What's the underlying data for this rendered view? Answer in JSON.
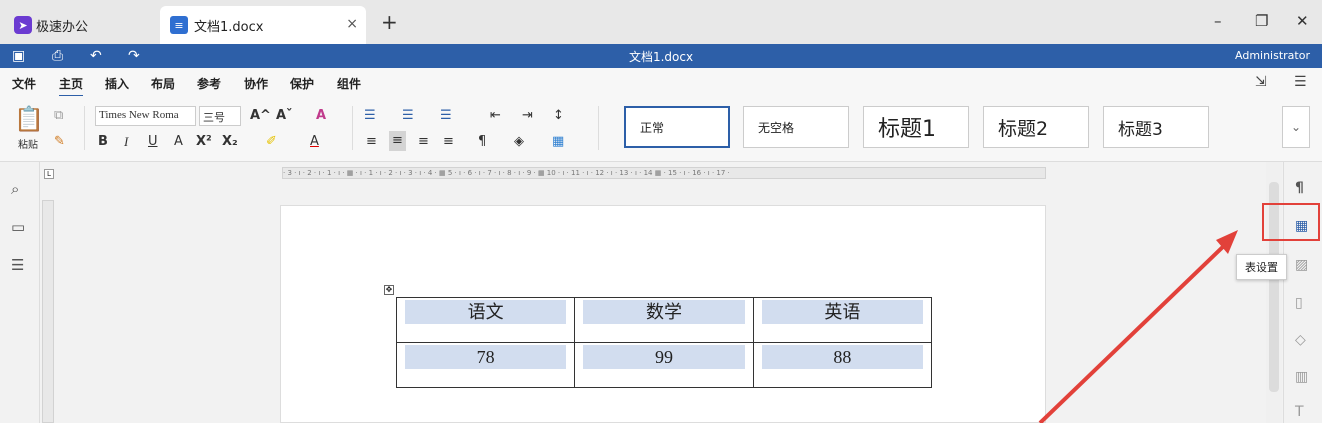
{
  "tabs": {
    "app_label": "极速办公",
    "doc_label": "文档1.docx",
    "close_glyph": "×",
    "new_tab_glyph": "+"
  },
  "window": {
    "minimize": "–",
    "restore": "❐",
    "close": "✕"
  },
  "titlebar": {
    "title": "文档1.docx",
    "user": "Administrator"
  },
  "menu": {
    "items": [
      "文件",
      "主页",
      "插入",
      "布局",
      "参考",
      "协作",
      "保护",
      "组件"
    ],
    "active": "主页"
  },
  "toolbar": {
    "paste_label": "粘贴",
    "font_name": "Times New Roma",
    "font_size": "三号",
    "bold": "B",
    "italic": "I",
    "underline": "U",
    "strike": "A",
    "superscript": "X²",
    "subscript": "X₂",
    "grow_font": "A^",
    "shrink_font": "Aˇ",
    "clear_format": "A"
  },
  "styles": [
    {
      "label": "正常",
      "active": true
    },
    {
      "label": "无空格",
      "active": false
    },
    {
      "label": "标题1",
      "active": false
    },
    {
      "label": "标题2",
      "active": false
    },
    {
      "label": "标题3",
      "active": false
    }
  ],
  "ruler_text": "· 3 · ı · 2 · ı · 1 · ı · ▦ · ı · 1 · ı · 2 · ı · 3 · ı · 4 · ▦ 5 · ı · 6 · ı · 7 · ı · 8 · ı · 9 · ▦ 10 · ı · 11 · ı · 12 · ı · 13 · ı · 14 ▦ · 15 · ı · 16 · ı · 17 ·",
  "table": {
    "rows": [
      [
        "语文",
        "数学",
        "英语"
      ],
      [
        "78",
        "99",
        "88"
      ]
    ]
  },
  "tooltip": "表设置",
  "colors": {
    "brand_blue": "#2d5fa8",
    "highlight_red": "#e2413a",
    "cell_fill": "#d2ddef"
  },
  "icons": {
    "left_rail": [
      "search-icon",
      "comment-icon",
      "outline-icon"
    ],
    "right_rail": [
      "paragraph-icon",
      "table-settings-icon",
      "image-icon",
      "header-footer-icon",
      "shape-icon",
      "chart-icon",
      "text-art-icon"
    ]
  }
}
